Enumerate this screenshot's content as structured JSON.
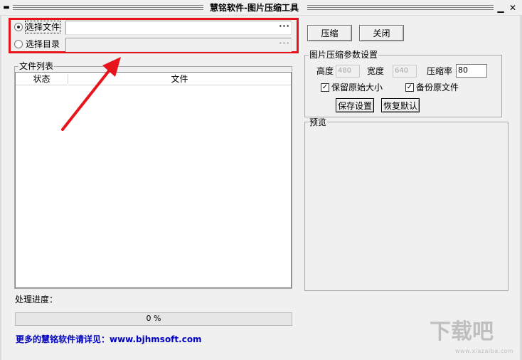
{
  "window": {
    "title": "慧铭软件-图片压缩工具",
    "sysmenu_glyph": "▬",
    "minimize_glyph": "▁",
    "close_glyph": "✕"
  },
  "source": {
    "select_file_label": "选择文件",
    "select_dir_label": "选择目录",
    "browse_glyph": "···",
    "file_path_value": "",
    "dir_path_value": "",
    "selected": "file"
  },
  "file_list": {
    "legend": "文件列表",
    "columns": [
      "状态",
      "文件"
    ]
  },
  "actions": {
    "compress_label": "压缩",
    "close_label": "关闭"
  },
  "params": {
    "legend": "图片压缩参数设置",
    "height_label": "高度",
    "height_value": "480",
    "width_label": "宽度",
    "width_value": "640",
    "ratio_label": "压缩率",
    "ratio_value": "80",
    "keep_size_label": "保留原始大小",
    "keep_size_checked": true,
    "backup_label": "备份原文件",
    "backup_checked": true,
    "save_label": "保存设置",
    "restore_label": "恢复默认",
    "check_glyph": "✓"
  },
  "preview": {
    "legend": "预览"
  },
  "progress": {
    "label": "处理进度：",
    "text": "0 %",
    "fraction": 0
  },
  "footer": {
    "link_text": "更多的慧铭软件请详见：www.bjhmsoft.com"
  },
  "watermark": {
    "text": "下载吧",
    "sub": "www.xiazaiba.com"
  },
  "colors": {
    "highlight": "#e8141b",
    "link": "#0000c0",
    "arrow": "#e8141b"
  }
}
